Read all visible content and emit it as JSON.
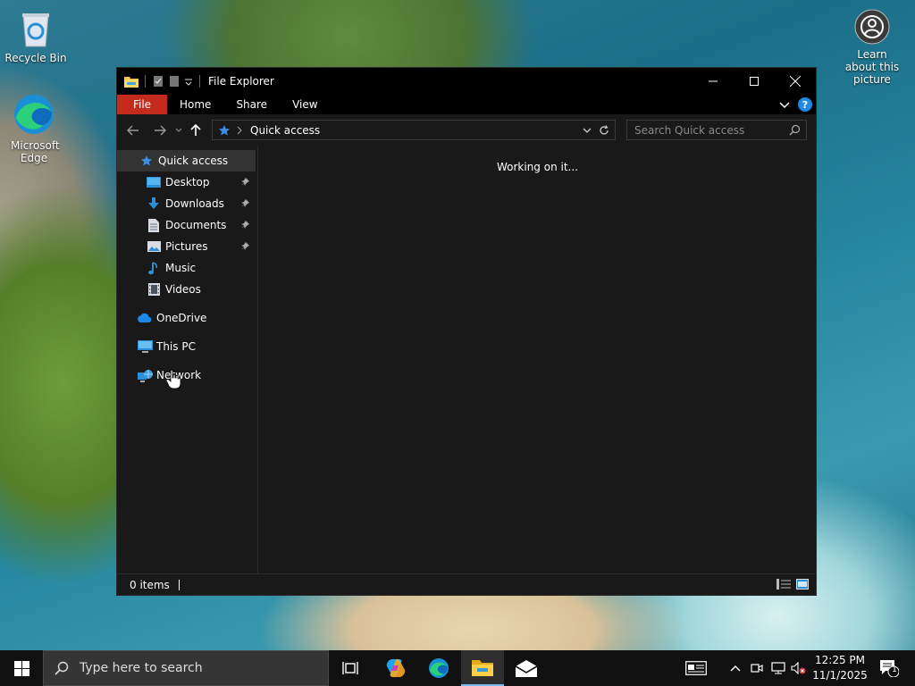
{
  "desktop": {
    "icons": [
      {
        "label": "Recycle Bin"
      },
      {
        "label": "Microsoft Edge"
      },
      {
        "label": "Learn about this picture"
      }
    ]
  },
  "window": {
    "title": "File Explorer",
    "ribbon_tabs": [
      "File",
      "Home",
      "Share",
      "View"
    ],
    "address": {
      "breadcrumb": "Quick access"
    },
    "search": {
      "placeholder": "Search Quick access"
    },
    "nav": {
      "quick_access": "Quick access",
      "items": [
        {
          "label": "Desktop",
          "pinned": true
        },
        {
          "label": "Downloads",
          "pinned": true
        },
        {
          "label": "Documents",
          "pinned": true
        },
        {
          "label": "Pictures",
          "pinned": true
        },
        {
          "label": "Music",
          "pinned": false
        },
        {
          "label": "Videos",
          "pinned": false
        }
      ],
      "onedrive": "OneDrive",
      "this_pc": "This PC",
      "network": "Network"
    },
    "content": {
      "status_message": "Working on it..."
    },
    "statusbar": {
      "item_count": "0 items"
    }
  },
  "taskbar": {
    "search_placeholder": "Type here to search",
    "clock": {
      "time": "12:25 PM",
      "date": "11/1/2025"
    },
    "notification_count": "1"
  },
  "colors": {
    "file_tab": "#c42b1c",
    "window_bg": "#191919",
    "titlebar_bg": "#000000",
    "accent": "#0078d4"
  }
}
